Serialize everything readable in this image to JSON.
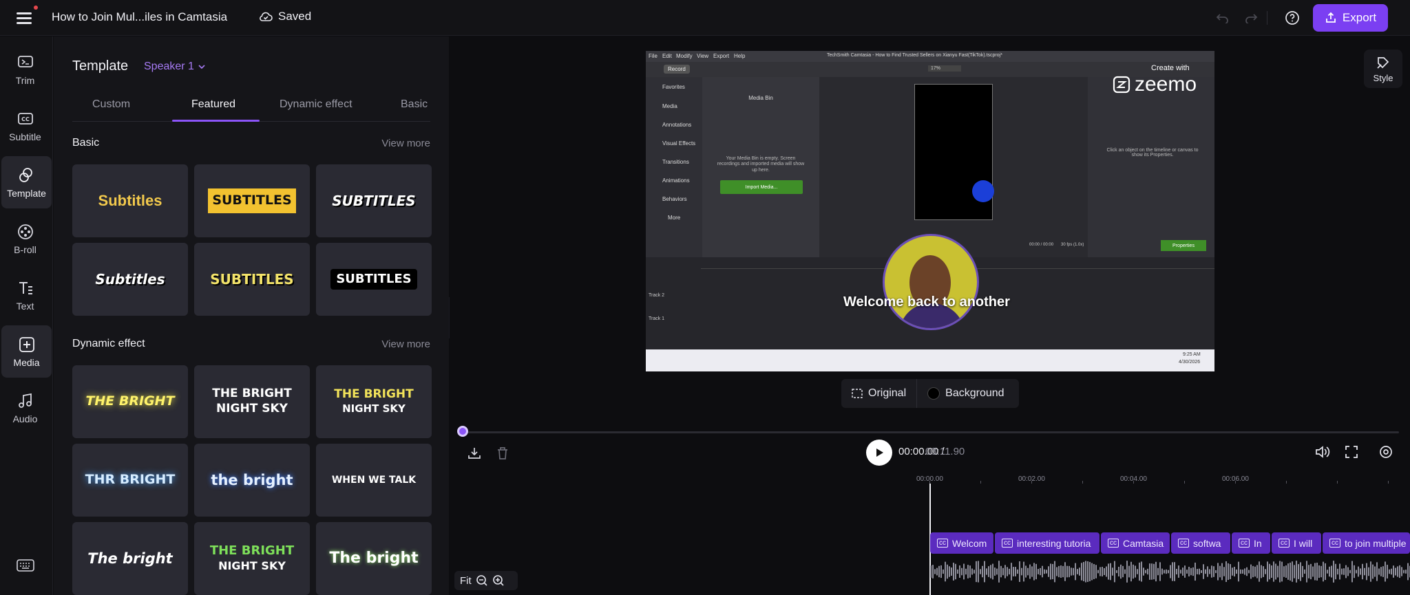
{
  "topbar": {
    "project_title": "How to Join Mul...iles in Camtasia",
    "saved_label": "Saved",
    "export_label": "Export",
    "accent": "#7b3ff2"
  },
  "rail": {
    "items": [
      {
        "label": "Trim",
        "icon": "trim-icon"
      },
      {
        "label": "Subtitle",
        "icon": "cc-icon"
      },
      {
        "label": "Template",
        "icon": "template-icon"
      },
      {
        "label": "B-roll",
        "icon": "broll-icon"
      },
      {
        "label": "Text",
        "icon": "text-icon"
      },
      {
        "label": "Media",
        "icon": "media-add-icon"
      },
      {
        "label": "Audio",
        "icon": "music-icon"
      }
    ],
    "active": "Template"
  },
  "panel": {
    "title": "Template",
    "speaker": "Speaker 1",
    "tabs": [
      "Custom",
      "Featured",
      "Dynamic effect",
      "Basic"
    ],
    "active_tab": "Featured",
    "basic": {
      "title": "Basic",
      "view_more": "View more",
      "cards": [
        "Subtitles",
        "SUBTITLES",
        "SUBTITLES",
        "Subtitles",
        "SUBTITLES",
        "SUBTITLES"
      ]
    },
    "dynamic": {
      "title": "Dynamic effect",
      "view_more": "View more",
      "cards": [
        {
          "a": "THE BRIGHT",
          "b": ""
        },
        {
          "a": "THE BRIGHT",
          "b": "NIGHT SKY"
        },
        {
          "a": "THE BRIGHT",
          "b": "NIGHT SKY"
        },
        {
          "a": "THR BRIGHT",
          "b": ""
        },
        {
          "a": "the bright",
          "b": ""
        },
        {
          "a": "WHEN WE TALK",
          "b": ""
        },
        {
          "a": "The bright",
          "b": ""
        },
        {
          "a": "THE BRIGHT",
          "b": "NIGHT SKY"
        },
        {
          "a": "The bright",
          "b": ""
        }
      ]
    }
  },
  "preview": {
    "style_label": "Style",
    "caption": "Welcome back to another",
    "watermark_top": "Create with",
    "watermark": "zeemo",
    "original_label": "Original",
    "background_label": "Background",
    "screen": {
      "menus": [
        "File",
        "Edit",
        "Modify",
        "View",
        "Export",
        "Help"
      ],
      "window_title": "TechSmith Camtasia - How to Find Trusted Sellers on Xianyu Fast(TikTok).tscproj*",
      "record": "Record",
      "zoom": "17%",
      "nav": [
        "Favorites",
        "Media",
        "Annotations",
        "Visual Effects",
        "Transitions",
        "Animations",
        "Behaviors"
      ],
      "more": "More",
      "media_bin_title": "Media Bin",
      "media_bin_text": "Your Media Bin is empty. Screen recordings and imported media will show up here.",
      "import_btn": "Import Media...",
      "props_text": "Click an object on the timeline or canvas to show its Properties.",
      "properties_btn": "Properties",
      "player_time": "00:00 / 00:00",
      "fps": "30 fps (1.0x)",
      "tracks": [
        "Track 2",
        "Track 1"
      ],
      "clock": "9:25 AM",
      "date": "4/30/2026"
    }
  },
  "player": {
    "time_current": "00:00.00 /",
    "time_total": "03:11.90",
    "ruler": [
      "00:00.00",
      "00:02.00",
      "00:04.00",
      "00:06.00"
    ],
    "zoom_label": "Fit",
    "clips": [
      "Welcom",
      "interesting tutoria",
      "Camtasia",
      "softwa",
      "In",
      "I will",
      "to join multiple"
    ]
  }
}
